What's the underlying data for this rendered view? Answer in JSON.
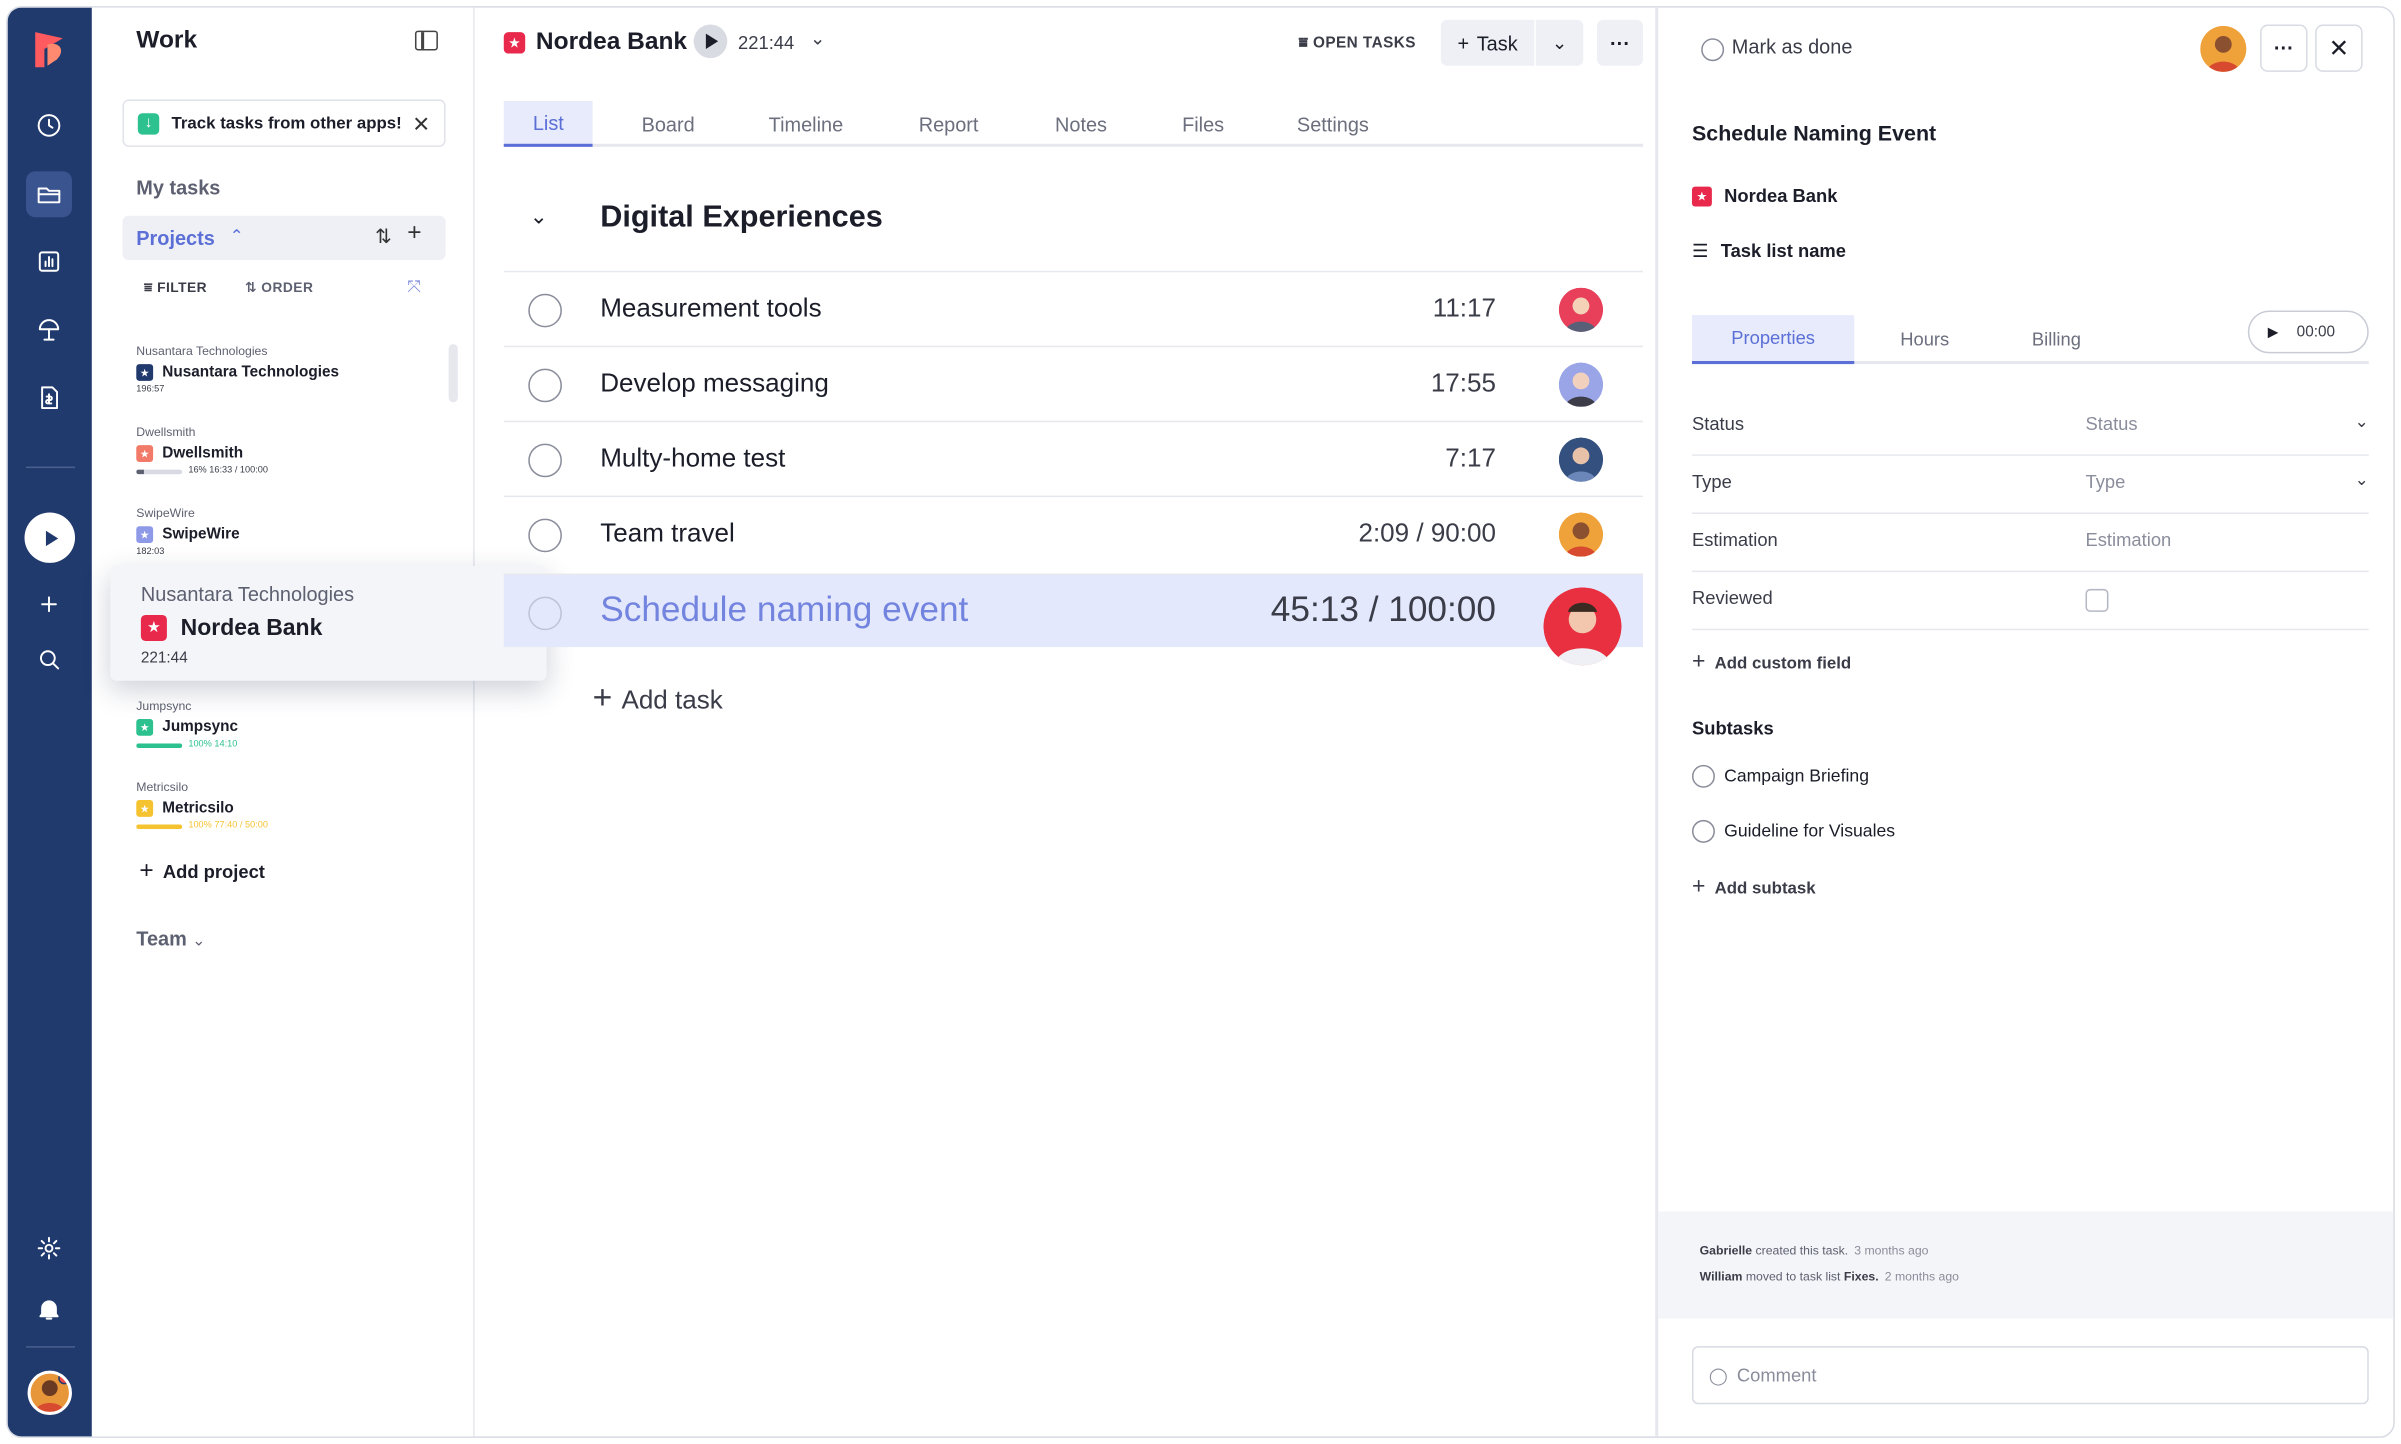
{
  "sidebar": {
    "title": "Work",
    "promo": "Track tasks from other apps!",
    "my_tasks": "My tasks",
    "projects_label": "Projects",
    "filter": "FILTER",
    "order": "ORDER",
    "projects": [
      {
        "client": "Nusantara Technologies",
        "name": "Nusantara Technologies",
        "color": "#213a6e",
        "meta": "196:57",
        "progress": null
      },
      {
        "client": "Dwellsmith",
        "name": "Dwellsmith",
        "color": "#f27a68",
        "meta": "16% 16:33 / 100:00",
        "progress": 0.16,
        "bar_color": "#5d6070"
      },
      {
        "client": "SwipeWire",
        "name": "SwipeWire",
        "color": "#8e9ae8",
        "meta": "182:03",
        "progress": null
      },
      {
        "client": "Jumpsync",
        "name": "Jumpsync",
        "color": "#2cc18f",
        "meta": "100% 14:10",
        "progress": 1.0,
        "bar_color": "#2cc18f"
      },
      {
        "client": "Metricsilo",
        "name": "Metricsilo",
        "color": "#f5c330",
        "meta": "100% 77:40 / 50:00",
        "progress": 1.0,
        "bar_color": "#f5c330"
      }
    ],
    "add_project": "Add project",
    "team": "Team",
    "dragging": {
      "client": "Nusantara Technologies",
      "name": "Nordea Bank",
      "time": "221:44"
    }
  },
  "header": {
    "project": "Nordea Bank",
    "timer": "221:44",
    "open_tasks": "OPEN TASKS",
    "task_button": "Task"
  },
  "tabs": [
    "List",
    "Board",
    "Timeline",
    "Report",
    "Notes",
    "Files",
    "Settings"
  ],
  "group": {
    "title": "Digital Experiences",
    "tasks": [
      {
        "name": "Measurement tools",
        "time": "11:17",
        "avatar": "#e8405a"
      },
      {
        "name": "Develop messaging",
        "time": "17:55",
        "avatar": "#9aa5e8"
      },
      {
        "name": "Multy-home test",
        "time": "7:17",
        "avatar": "#34507e"
      },
      {
        "name": "Team travel",
        "time": "2:09 / 90:00",
        "avatar": "#f0a23a"
      }
    ],
    "selected": {
      "name": "Schedule naming event",
      "time": "45:13 / 100:00",
      "avatar": "#e83040"
    },
    "add_task": "Add task"
  },
  "detail": {
    "mark_done": "Mark as done",
    "title": "Schedule Naming Event",
    "project": "Nordea Bank",
    "task_list": "Task list name",
    "tabs": [
      "Properties",
      "Hours",
      "Billing"
    ],
    "timer": "00:00",
    "properties": [
      {
        "key": "Status",
        "value": "Status"
      },
      {
        "key": "Type",
        "value": "Type"
      },
      {
        "key": "Estimation",
        "value": "Estimation"
      },
      {
        "key": "Reviewed",
        "value": ""
      }
    ],
    "add_custom_field": "Add custom field",
    "subtasks_title": "Subtasks",
    "subtasks": [
      "Campaign Briefing",
      "Guideline for Visuales"
    ],
    "add_subtask": "Add subtask",
    "activity": [
      {
        "user": "Gabrielle",
        "text": "created this task.",
        "ago": "3 months ago"
      },
      {
        "user": "William",
        "text": "moved to task list",
        "target": "Fixes.",
        "ago": "2 months ago"
      }
    ],
    "comment_placeholder": "Comment"
  }
}
